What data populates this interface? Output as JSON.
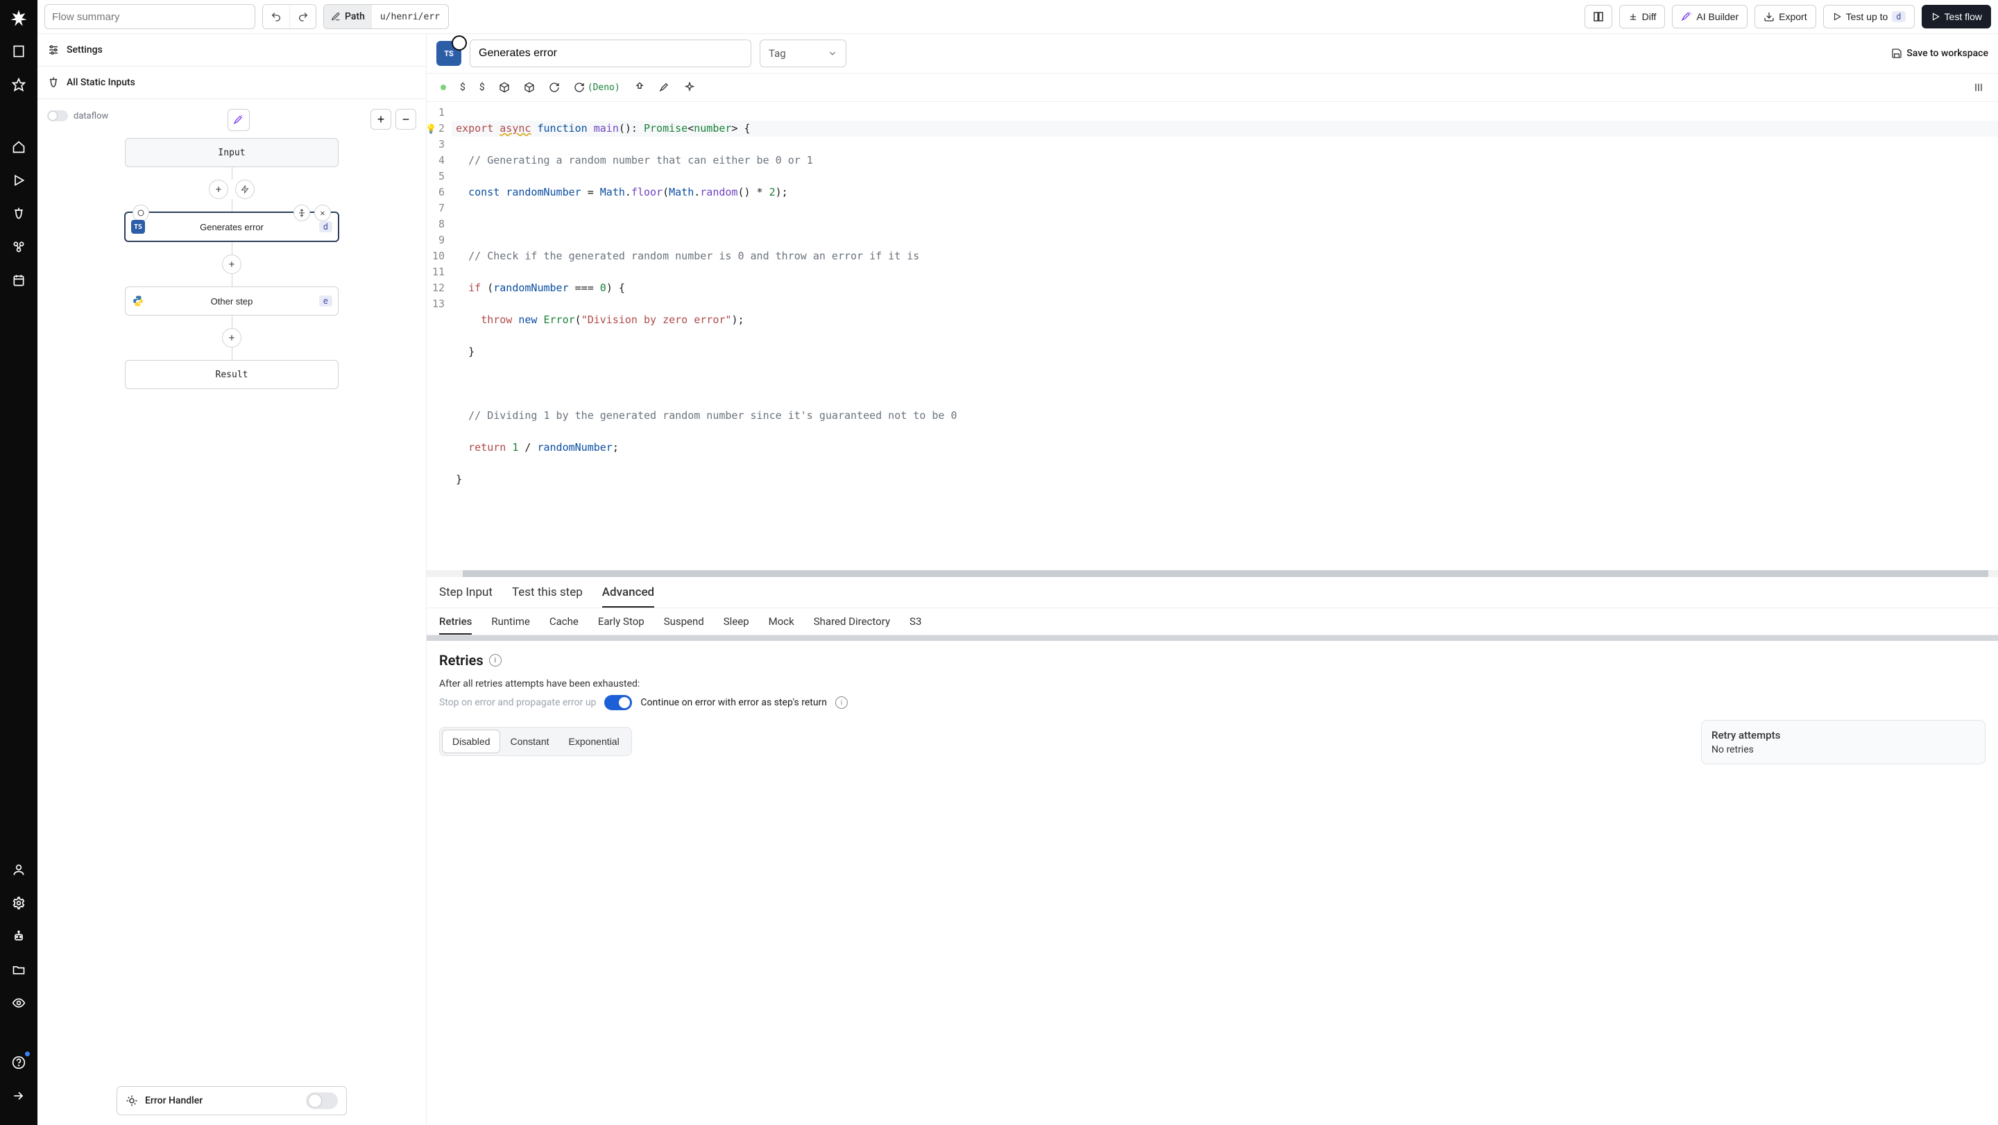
{
  "topbar": {
    "summary_placeholder": "Flow summary",
    "path_label": "Path",
    "path_value": "u/henri/err",
    "diff": "Diff",
    "ai_builder": "AI Builder",
    "export": "Export",
    "test_up_to": "Test up to",
    "test_up_to_badge": "d",
    "test_flow": "Test flow"
  },
  "left": {
    "settings": "Settings",
    "all_static": "All Static Inputs",
    "dataflow": "dataflow",
    "nodes": {
      "input": "Input",
      "gen_err": "Generates error",
      "gen_err_badge": "d",
      "other": "Other step",
      "other_badge": "e",
      "result": "Result"
    },
    "error_handler": "Error Handler"
  },
  "step": {
    "name": "Generates error",
    "tag_placeholder": "Tag",
    "save": "Save to workspace",
    "deno": "(Deno)"
  },
  "code": {
    "lines": [
      "export async function main(): Promise<number> {",
      "  // Generating a random number that can either be 0 or 1",
      "  const randomNumber = Math.floor(Math.random() * 2);",
      "",
      "  // Check if the generated random number is 0 and throw an error if it is",
      "  if (randomNumber === 0) {",
      "    throw new Error(\"Division by zero error\");",
      "  }",
      "",
      "  // Dividing 1 by the generated random number since it's guaranteed not to be 0",
      "  return 1 / randomNumber;",
      "}",
      ""
    ]
  },
  "tabs1": [
    "Step Input",
    "Test this step",
    "Advanced"
  ],
  "tabs1_active": 2,
  "tabs2": [
    "Retries",
    "Runtime",
    "Cache",
    "Early Stop",
    "Suspend",
    "Sleep",
    "Mock",
    "Shared Directory",
    "S3"
  ],
  "tabs2_active": 0,
  "retries": {
    "title": "Retries",
    "hint": "After all retries attempts have been exhausted:",
    "left": "Stop on error and propagate error up",
    "right": "Continue on error with error as step's return",
    "modes": [
      "Disabled",
      "Constant",
      "Exponential"
    ],
    "modes_active": 0,
    "info_title": "Retry attempts",
    "info_val": "No retries"
  }
}
